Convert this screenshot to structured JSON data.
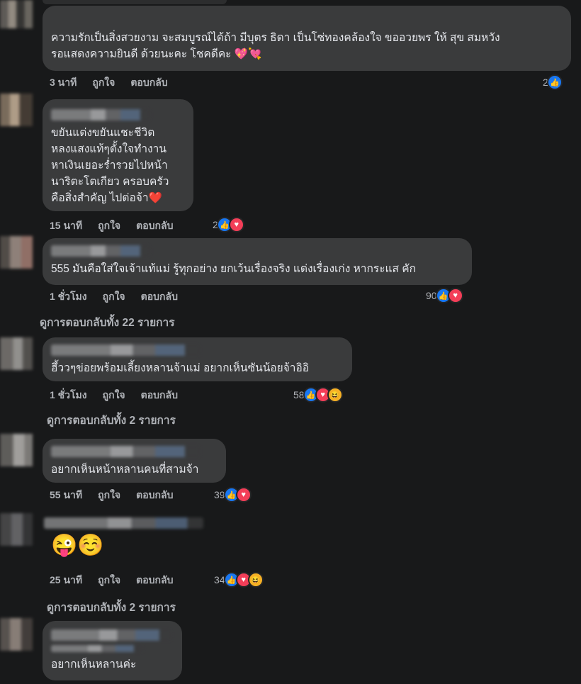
{
  "colors": {
    "background": "#18191a",
    "bubble": "#3a3b3c",
    "like": "#1877f2",
    "love": "#f33e58",
    "haha": "#f7b125",
    "meta_text": "#b0b3b8"
  },
  "labels": {
    "like": "ถูกใจ",
    "reply": "ตอบกลับ"
  },
  "comments": [
    {
      "text": "ความรักเป็นสิ่งสวยงาม จะสมบูรณ์ได้ถ้า มีบุตร ธิดา เป็นโซ่ทองคล้องใจ ขออวยพร ให้ สุข สมหวัง\nรอแสดงความยินดี ด้วยนะคะ โชคดีคะ 💖💘",
      "time": "3 นาที",
      "reactions_count": "2",
      "reaction_icons": [
        "like-icon"
      ]
    },
    {
      "text": "ขยันแต่งขยันแชะชีวิต\nหลงแสงแท้ๆตั้งใจทำงาน\nหาเงินเยอะร่ำรวยไปหน้า\nนาริตะโตเกียว ครอบครัว\nคือสิ่งสำคัญ ไปต่อจ้า❤️",
      "time": "15 นาที",
      "reactions_count": "2",
      "reaction_icons": [
        "like-icon",
        "love-icon"
      ]
    },
    {
      "text": "555 มันคือใส่ใจเจ้าแท้แม่ รู้ทุกอย่าง ยกเว้นเรื่องจริง แต่งเรื่องเก่ง หากระแส คัก",
      "time": "1 ชั่วโมง",
      "reactions_count": "90",
      "reaction_icons": [
        "like-icon",
        "love-icon"
      ],
      "view_replies": "ดูการตอบกลับทั้ง 22 รายการ"
    },
    {
      "text": "ฮึ้ววๆข่อยพร้อมเลี้ยงหลานจ้าแม่ อยากเห็นซันน้อยจ้าอิอิ",
      "time": "1 ชั่วโมง",
      "reactions_count": "58",
      "reaction_icons": [
        "like-icon",
        "love-icon",
        "haha-icon"
      ],
      "view_replies": "ดูการตอบกลับทั้ง 2 รายการ"
    },
    {
      "text": "อยากเห็นหน้าหลานคนที่สามจ้า",
      "time": "55 นาที",
      "reactions_count": "39",
      "reaction_icons": [
        "like-icon",
        "love-icon"
      ]
    },
    {
      "text": "😜☺️",
      "time": "25 นาที",
      "reactions_count": "34",
      "reaction_icons": [
        "like-icon",
        "love-icon",
        "haha-icon"
      ],
      "view_replies": "ดูการตอบกลับทั้ง 2 รายการ"
    },
    {
      "text": "อยากเห็นหลานค่ะ"
    }
  ]
}
